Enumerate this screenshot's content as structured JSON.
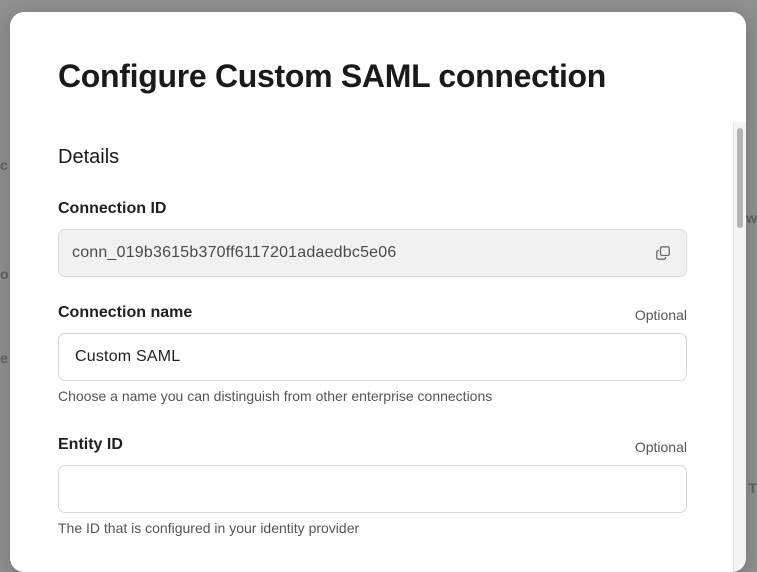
{
  "modal": {
    "title": "Configure Custom SAML connection"
  },
  "details": {
    "section_title": "Details",
    "connection_id": {
      "label": "Connection ID",
      "value": "conn_019b3615b370ff6117201adaedbc5e06",
      "copy_icon": "copy-icon"
    },
    "connection_name": {
      "label": "Connection name",
      "optional_label": "Optional",
      "value": "Custom SAML",
      "help": "Choose a name you can distinguish from other enterprise connections"
    },
    "entity_id": {
      "label": "Entity ID",
      "optional_label": "Optional",
      "value": "",
      "help": "The ID that is configured in your identity provider"
    }
  },
  "colors": {
    "overlay": "#8f8f8f",
    "modal_bg": "#ffffff",
    "readonly_bg": "#f1f1f1",
    "border": "#d7d7d7"
  }
}
